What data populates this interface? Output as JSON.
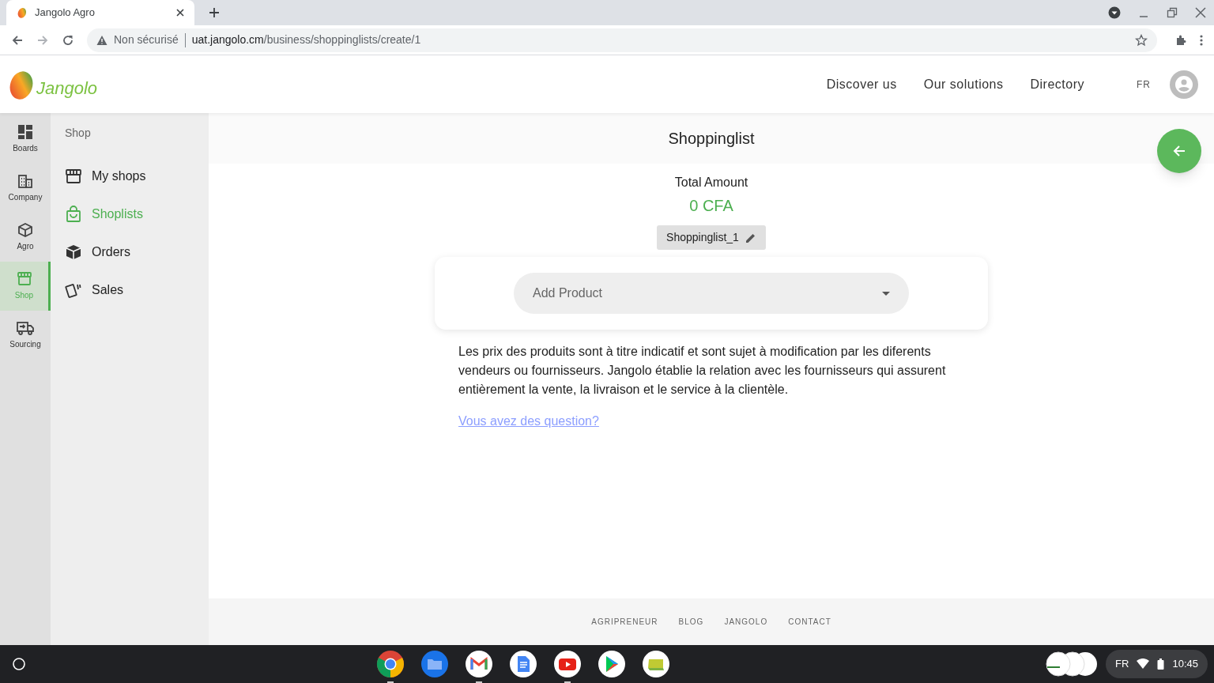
{
  "browser": {
    "tab_title": "Jangolo Agro",
    "security": "Non sécurisé",
    "url_host": "uat.jangolo.cm",
    "url_path": "/business/shoppinglists/create/1"
  },
  "header": {
    "logo": "Jangolo",
    "nav": [
      "Discover us",
      "Our solutions",
      "Directory"
    ],
    "language": "FR"
  },
  "rail": [
    {
      "label": "Boards",
      "selected": false
    },
    {
      "label": "Company",
      "selected": false
    },
    {
      "label": "Agro",
      "selected": false
    },
    {
      "label": "Shop",
      "selected": true
    },
    {
      "label": "Sourcing",
      "selected": false
    }
  ],
  "submenu": {
    "title": "Shop",
    "items": [
      {
        "label": "My shops",
        "selected": false
      },
      {
        "label": "Shoplists",
        "selected": true
      },
      {
        "label": "Orders",
        "selected": false
      },
      {
        "label": "Sales",
        "selected": false
      }
    ]
  },
  "main": {
    "title": "Shoppinglist",
    "total_label": "Total Amount",
    "total_value": "0 CFA",
    "list_name": "Shoppinglist_1",
    "product_placeholder": "Add Product",
    "notice": "Les prix des produits sont à titre indicatif et sont sujet à modification par les diferents vendeurs ou fournisseurs. Jangolo établie la relation avec les fournisseurs qui assurent entièrement la vente, la livraison et le service à la clientèle.",
    "question_link": "Vous avez des question?"
  },
  "footer": [
    "AGRIPRENEUR",
    "BLOG",
    "JANGOLO",
    "CONTACT"
  ],
  "shelf": {
    "apps": [
      {
        "kind": "chrome",
        "running": true
      },
      {
        "kind": "files",
        "running": false
      },
      {
        "kind": "gmail",
        "running": true
      },
      {
        "kind": "docs",
        "running": false
      },
      {
        "kind": "youtube",
        "running": true
      },
      {
        "kind": "play",
        "running": false
      },
      {
        "kind": "notes",
        "running": false
      }
    ],
    "language": "FR",
    "time": "10:45"
  }
}
